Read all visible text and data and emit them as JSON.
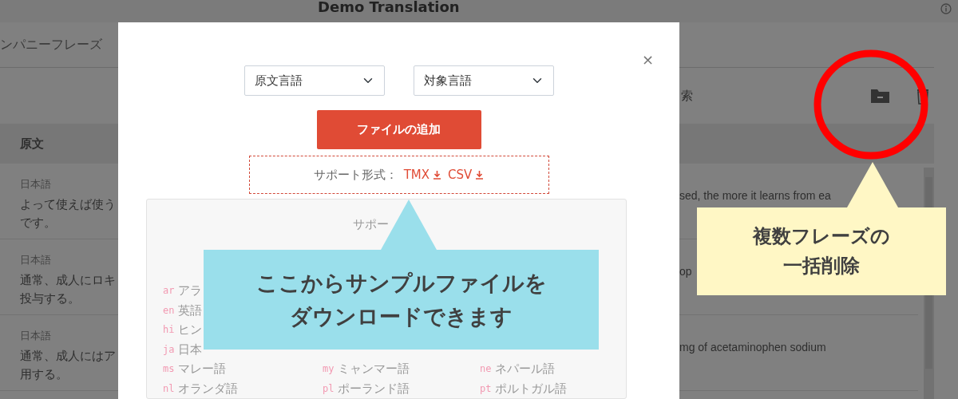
{
  "page": {
    "title": "Demo Translation",
    "tab": "ンパニーフレーズ",
    "search_fragment": "索"
  },
  "table": {
    "column_1": "原文",
    "rows": [
      {
        "language": "日本語",
        "source_lines": [
          "よって使えば使う",
          "です。"
        ],
        "column_2": "sed, the more it learns from ea"
      },
      {
        "language": "日本語",
        "source_lines": [
          "通常、成人にロキ",
          "投与する。"
        ],
        "column_2": "op"
      },
      {
        "language": "日本語",
        "source_lines": [
          "通常、成人にはア",
          "用する。"
        ],
        "column_2": "mg of acetaminophen sodium"
      }
    ]
  },
  "modal": {
    "close": "×",
    "source_select": "原文言語",
    "target_select": "対象言語",
    "add_button": "ファイルの追加",
    "formats_label": "サポート形式：",
    "formats": [
      "TMX",
      "CSV"
    ],
    "panel_title": "サポー",
    "language_columns": [
      [
        {
          "code": "ar",
          "name": "アラ"
        },
        {
          "code": "en",
          "name": "英語"
        },
        {
          "code": "hi",
          "name": "ヒン"
        },
        {
          "code": "ja",
          "name": "日本"
        },
        {
          "code": "ms",
          "name": "マレー語"
        },
        {
          "code": "nl",
          "name": "オランダ語"
        }
      ],
      [
        {
          "code": "my",
          "name": "ミャンマー語"
        },
        {
          "code": "pl",
          "name": "ポーランド語"
        }
      ],
      [
        {
          "code": "ne",
          "name": "ネパール語"
        },
        {
          "code": "pt",
          "name": "ポルトガル語"
        }
      ]
    ]
  },
  "callouts": [
    {
      "lines": [
        "ここからサンプルファイルを",
        "ダウンロードできます"
      ],
      "color": "#9adfeb"
    },
    {
      "lines": [
        "複数フレーズの",
        "一括削除"
      ],
      "color": "#fff7c5"
    }
  ]
}
